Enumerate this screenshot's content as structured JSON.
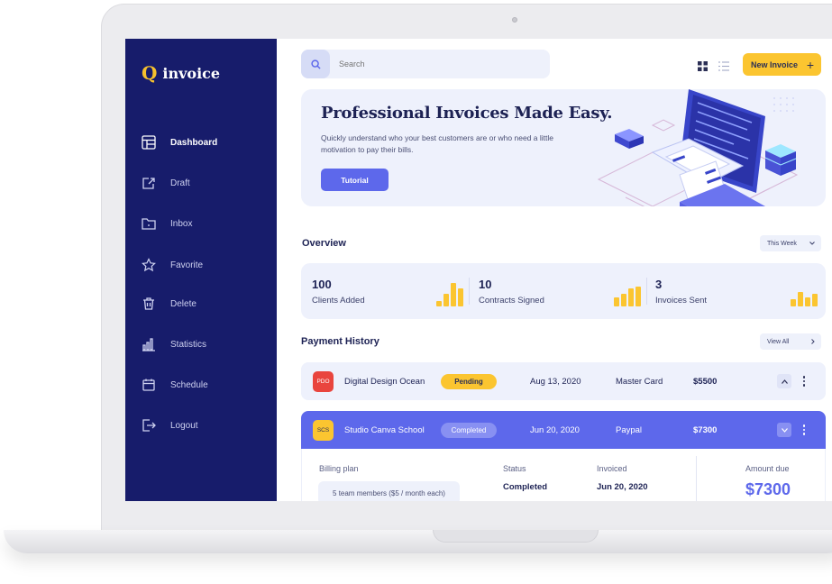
{
  "app": {
    "logo_mark": "Q",
    "logo_text": "invoice"
  },
  "sidebar": {
    "items": [
      {
        "label": "Dashboard",
        "icon": "dashboard-icon",
        "active": true
      },
      {
        "label": "Draft",
        "icon": "draft-icon"
      },
      {
        "label": "Inbox",
        "icon": "inbox-icon"
      },
      {
        "label": "Favorite",
        "icon": "star-icon"
      },
      {
        "label": "Delete",
        "icon": "trash-icon"
      },
      {
        "label": "Statistics",
        "icon": "bar-chart-icon"
      },
      {
        "label": "Schedule",
        "icon": "calendar-icon"
      },
      {
        "label": "Logout",
        "icon": "logout-icon"
      }
    ]
  },
  "header": {
    "search_placeholder": "Search",
    "new_invoice_label": "New Invoice",
    "new_invoice_icon": "+"
  },
  "hero": {
    "title": "Professional Invoices Made Easy.",
    "description": "Quickly understand who your best customers are or who need a little motivation to pay their bills.",
    "button_label": "Tutorial"
  },
  "overview": {
    "title": "Overview",
    "period": "This Week",
    "stats": [
      {
        "value": "100",
        "label": "Clients Added"
      },
      {
        "value": "10",
        "label": "Contracts Signed"
      },
      {
        "value": "3",
        "label": "Invoices Sent"
      }
    ]
  },
  "payments": {
    "title": "Payment History",
    "view_all": "View All",
    "rows": [
      {
        "initials": "PDO",
        "name": "Digital Design Ocean",
        "status": "Pending",
        "date": "Aug 13, 2020",
        "method": "Master Card",
        "amount": "$5500"
      },
      {
        "initials": "SCS",
        "name": "Studio Canva School",
        "status": "Completed",
        "date": "Jun 20, 2020",
        "method": "Paypal",
        "amount": "$7300"
      }
    ],
    "details": {
      "billing_plan_label": "Billing plan",
      "billing_plan_value": "5 team members ($5 / month each)",
      "status_label": "Status",
      "status_value": "Completed",
      "invoiced_label": "Invoiced",
      "invoiced_value": "Jun 20, 2020",
      "amount_due_label": "Amount due",
      "amount_due_value": "$7300"
    }
  },
  "colors": {
    "sidebar": "#171c6b",
    "accent": "#5d68eb",
    "yellow": "#fbc530",
    "panel": "#eef1fc"
  }
}
